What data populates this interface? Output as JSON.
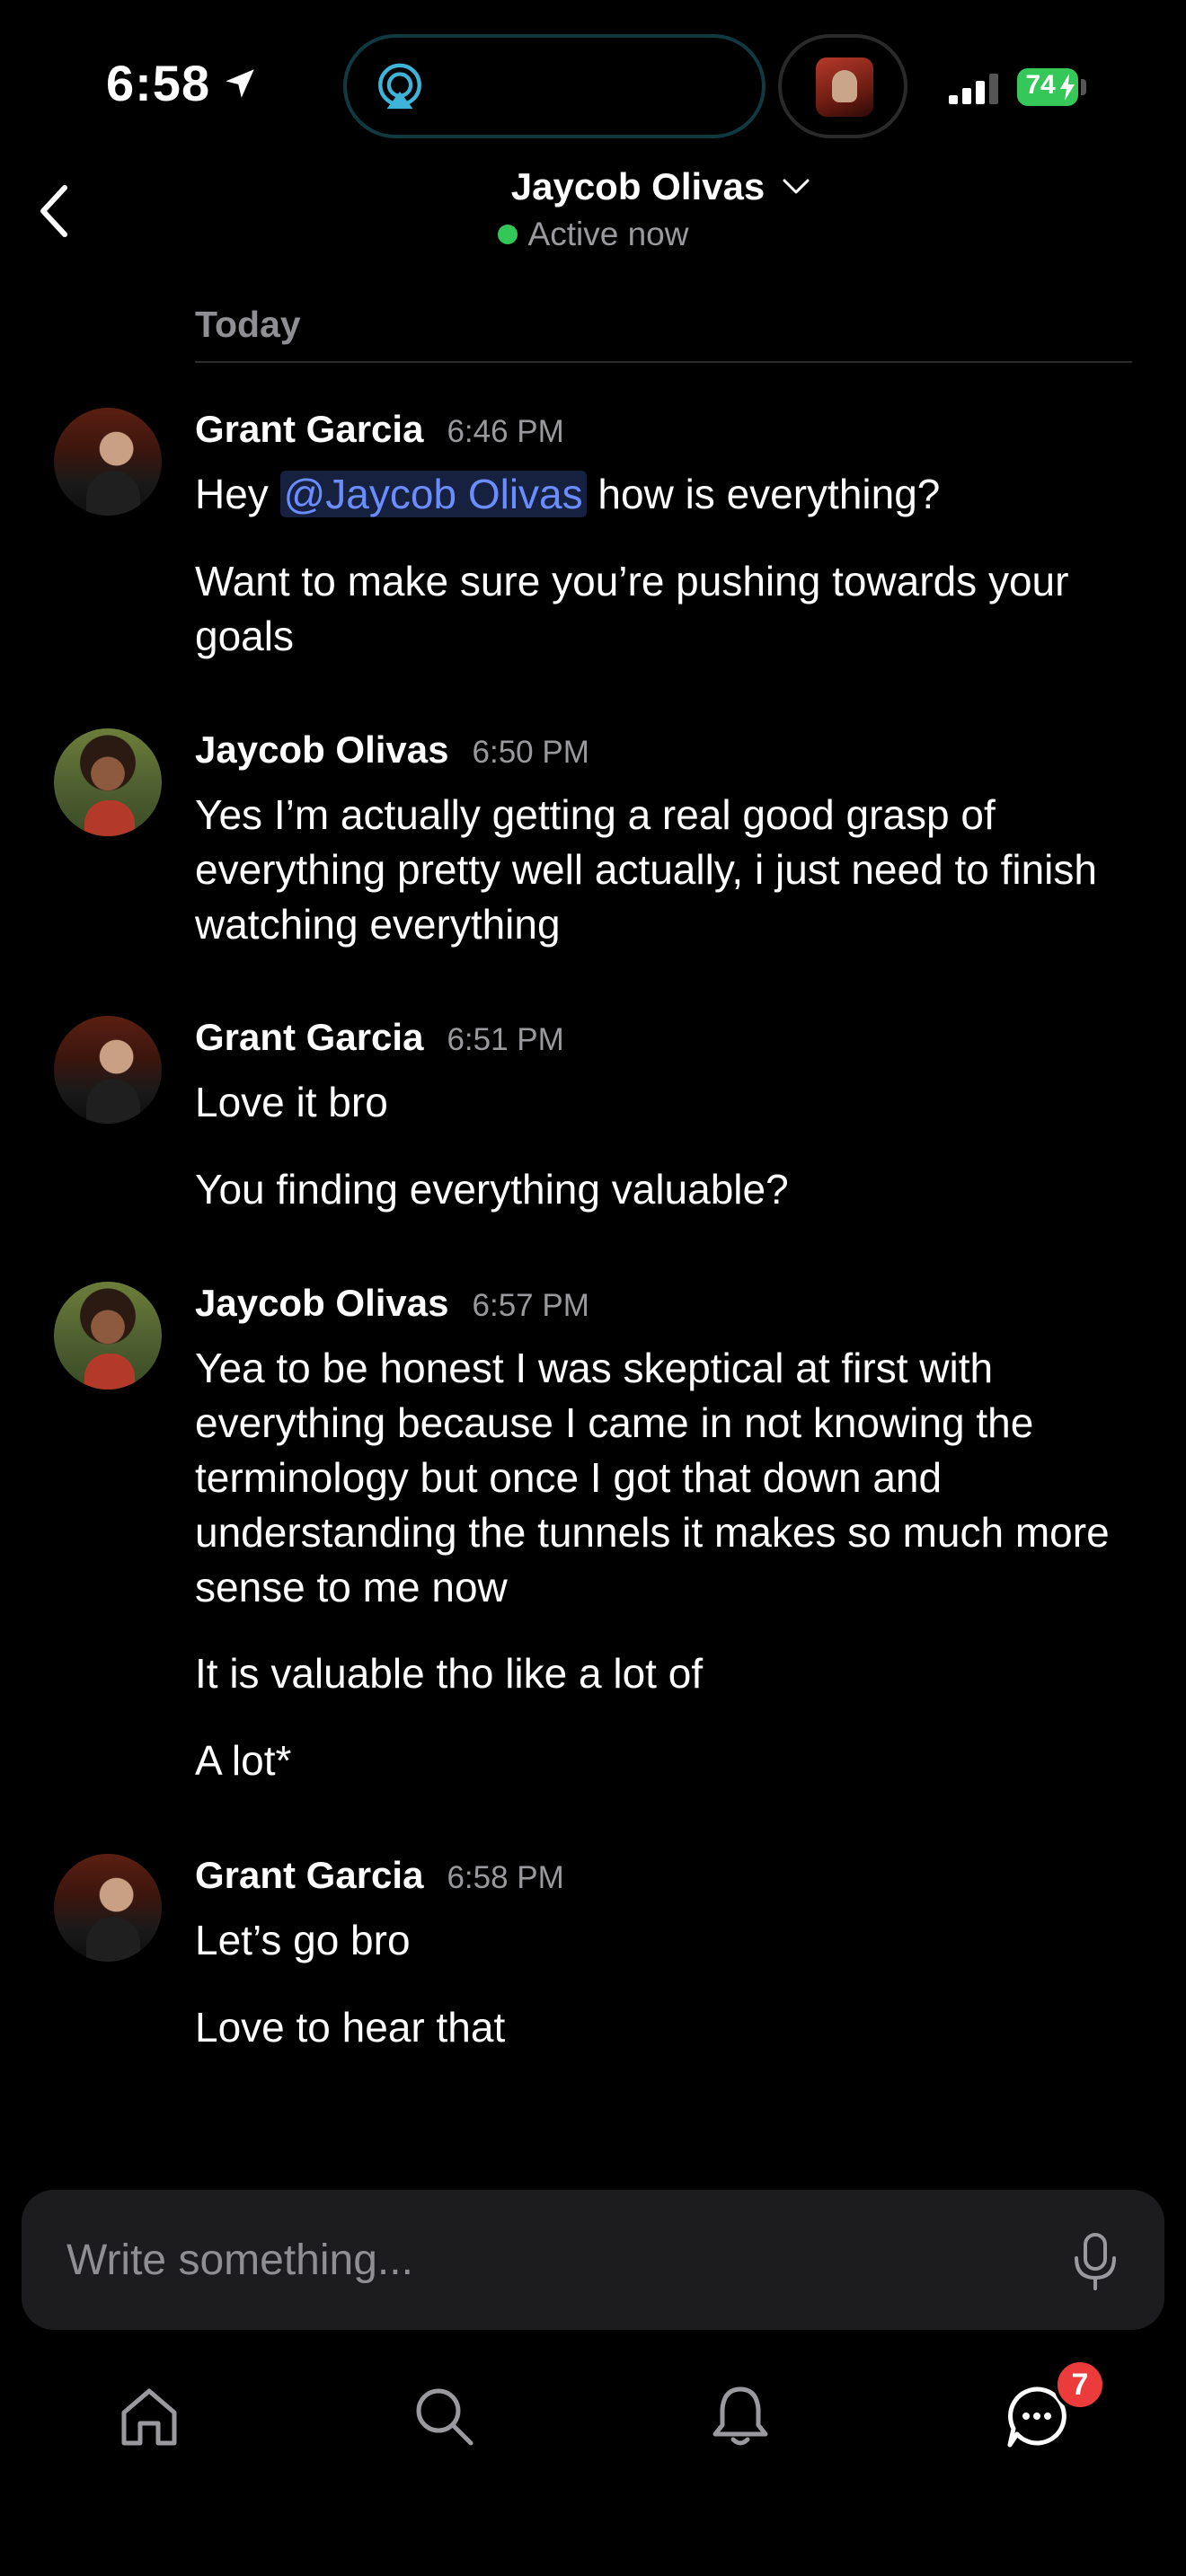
{
  "status_bar": {
    "time": "6:58",
    "battery": "74",
    "icons": [
      "location-arrow-icon",
      "airplay-icon",
      "signal-icon",
      "battery-icon"
    ]
  },
  "header": {
    "title": "Jaycob Olivas",
    "status": "Active now",
    "status_color": "#33c659"
  },
  "day_divider": "Today",
  "messages": [
    {
      "sender": "Grant Garcia",
      "time": "6:46 PM",
      "lines": [
        {
          "before": "Hey ",
          "mention": "@Jaycob Olivas",
          "after": " how is everything?"
        },
        "Want to make sure you’re pushing towards your goals"
      ]
    },
    {
      "sender": "Jaycob Olivas",
      "time": "6:50 PM",
      "lines": [
        "Yes I’m actually getting a real good grasp of everything pretty well actually, i just need to finish watching everything"
      ]
    },
    {
      "sender": "Grant Garcia",
      "time": "6:51 PM",
      "lines": [
        "Love it bro",
        "You finding everything valuable?"
      ]
    },
    {
      "sender": "Jaycob Olivas",
      "time": "6:57 PM",
      "lines": [
        "Yea to be honest I was skeptical at first with everything because I came in not knowing the terminology but once I got that down and understanding the tunnels it makes so much more sense to me now",
        "It is valuable tho like a lot of",
        "A lot*"
      ]
    },
    {
      "sender": "Grant Garcia",
      "time": "6:58 PM",
      "lines": [
        "Let’s go bro",
        "Love to hear that"
      ]
    }
  ],
  "composer": {
    "placeholder": "Write something..."
  },
  "tab_bar": {
    "items": [
      "home-icon",
      "search-icon",
      "bell-icon",
      "chat-icon"
    ],
    "chat_badge": "7",
    "badge_color": "#ec3b3b"
  },
  "colors": {
    "mention": "#6b8cff",
    "background": "#000000"
  }
}
